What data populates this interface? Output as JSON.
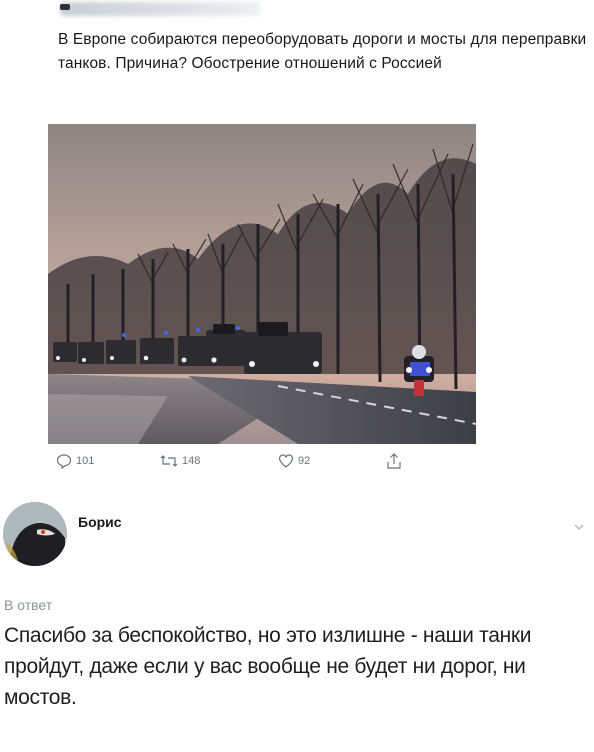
{
  "tweet": {
    "text": "В Европе собираются переоборудовать дороги и мосты для переправки танков. Причина? Обострение отношений с Россией",
    "actions": {
      "reply_count": "101",
      "retweet_count": "148",
      "like_count": "92"
    },
    "icons": [
      "reply-icon",
      "retweet-icon",
      "like-icon",
      "share-icon"
    ]
  },
  "reply": {
    "author": "Борис",
    "in_reply_label": "В ответ",
    "text": "Спасибо за беспокойство, но это излишне - наши танки пройдут, даже если у вас вообще не будет ни дорог, ни мостов.",
    "icons": [
      "chevron-down-icon"
    ]
  },
  "colors": {
    "icon_gray": "#69727d",
    "text_dark": "#16181c",
    "muted": "#8d949b"
  }
}
